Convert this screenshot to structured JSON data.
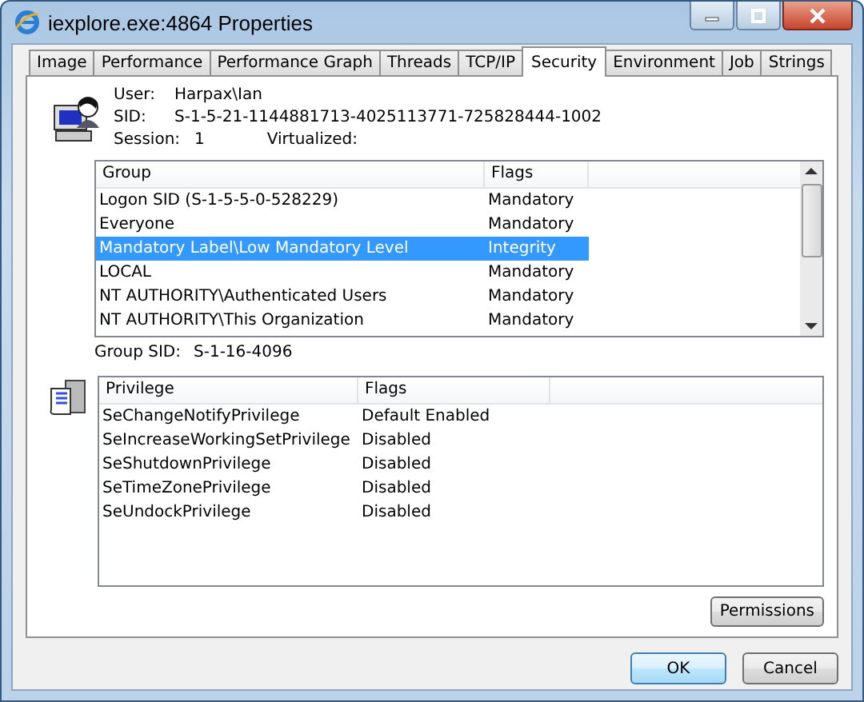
{
  "window": {
    "title": "iexplore.exe:4864 Properties"
  },
  "tabs": [
    {
      "label": "Image",
      "selected": false
    },
    {
      "label": "Performance",
      "selected": false
    },
    {
      "label": "Performance Graph",
      "selected": false
    },
    {
      "label": "Threads",
      "selected": false
    },
    {
      "label": "TCP/IP",
      "selected": false
    },
    {
      "label": "Security",
      "selected": true
    },
    {
      "label": "Environment",
      "selected": false
    },
    {
      "label": "Job",
      "selected": false
    },
    {
      "label": "Strings",
      "selected": false
    }
  ],
  "user": {
    "user_label": "User:",
    "user": "Harpax\\Ian",
    "sid_label": "SID:",
    "sid": "S-1-5-21-1144881713-4025113771-725828444-1002",
    "session_label": "Session:",
    "session": "1",
    "virtualized_label": "Virtualized:"
  },
  "groups": {
    "columns": [
      "Group",
      "Flags"
    ],
    "rows": [
      {
        "group": "Logon SID (S-1-5-5-0-528229)",
        "flags": "Mandatory",
        "selected": false
      },
      {
        "group": "Everyone",
        "flags": "Mandatory",
        "selected": false
      },
      {
        "group": "Mandatory Label\\Low Mandatory Level",
        "flags": "Integrity",
        "selected": true
      },
      {
        "group": "LOCAL",
        "flags": "Mandatory",
        "selected": false
      },
      {
        "group": "NT AUTHORITY\\Authenticated Users",
        "flags": "Mandatory",
        "selected": false
      },
      {
        "group": "NT AUTHORITY\\This Organization",
        "flags": "Mandatory",
        "selected": false
      }
    ]
  },
  "group_sid": {
    "label": "Group SID:",
    "value": "S-1-16-4096"
  },
  "privileges": {
    "columns": [
      "Privilege",
      "Flags"
    ],
    "rows": [
      {
        "privilege": "SeChangeNotifyPrivilege",
        "flags": "Default Enabled"
      },
      {
        "privilege": "SeIncreaseWorkingSetPrivilege",
        "flags": "Disabled"
      },
      {
        "privilege": "SeShutdownPrivilege",
        "flags": "Disabled"
      },
      {
        "privilege": "SeTimeZonePrivilege",
        "flags": "Disabled"
      },
      {
        "privilege": "SeUndockPrivilege",
        "flags": "Disabled"
      }
    ]
  },
  "permissions_button": "Permissions",
  "buttons": [
    "OK",
    "Cancel"
  ]
}
